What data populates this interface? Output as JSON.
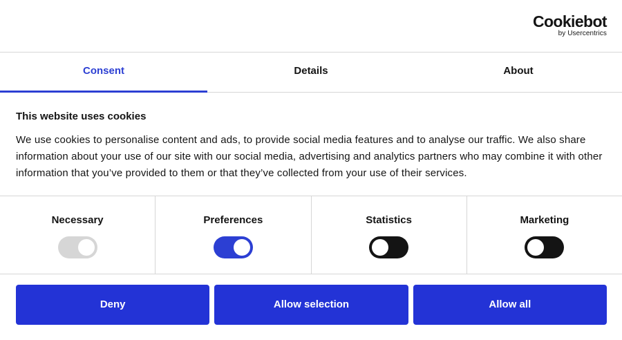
{
  "brand": {
    "name": "Cookiebot",
    "byline": "by Usercentrics"
  },
  "tabs": [
    {
      "label": "Consent",
      "active": true
    },
    {
      "label": "Details",
      "active": false
    },
    {
      "label": "About",
      "active": false
    }
  ],
  "content": {
    "title": "This website uses cookies",
    "description": "We use cookies to personalise content and ads, to provide social media features and to analyse our traffic. We also share information about your use of our site with our social media, advertising and analytics partners who may combine it with other information that you’ve provided to them or that they’ve collected from your use of their services."
  },
  "categories": [
    {
      "label": "Necessary",
      "checked": true,
      "disabled": true
    },
    {
      "label": "Preferences",
      "checked": true,
      "disabled": false
    },
    {
      "label": "Statistics",
      "checked": false,
      "disabled": false
    },
    {
      "label": "Marketing",
      "checked": false,
      "disabled": false
    }
  ],
  "buttons": {
    "deny": "Deny",
    "allow_selection": "Allow selection",
    "allow_all": "Allow all"
  },
  "colors": {
    "accent": "#2333d6",
    "active_tab": "#2c3fd3",
    "toggle_off": "#141414",
    "toggle_disabled": "#d6d6d6",
    "divider": "#d6d6d6"
  }
}
